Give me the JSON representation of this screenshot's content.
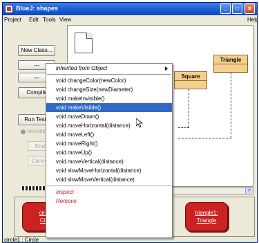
{
  "window": {
    "title": "BlueJ:  shapes",
    "buttons": {
      "minimize": "_",
      "maximize": "□",
      "close": "✕"
    }
  },
  "menubar": [
    "Project",
    "Edit",
    "Tools",
    "View",
    "Help"
  ],
  "sidebar": {
    "new_class": "New Class...",
    "arrow_btn_1": "---",
    "arrow_btn_2": "—",
    "compile": "Compile",
    "run_tests": "Run Tests",
    "recording": "recording",
    "end": "End",
    "cancel": "Cancel"
  },
  "diagram": {
    "classes": [
      {
        "name": "Triangle"
      },
      {
        "name": "Square"
      }
    ]
  },
  "context_menu": {
    "inherited": "inherited from Object",
    "methods": [
      "void changeColor(newColor)",
      "void changeSize(newDiameter)",
      "void makeInvisible()",
      "void makeVisible()",
      "void moveDown()",
      "void moveHorizontal(distance)",
      "void moveLeft()",
      "void moveRight()",
      "void moveUp()",
      "void moveVertical(distance)",
      "void slowMoveHorizontal(distance)",
      "void slowMoveVertical(distance)"
    ],
    "highlighted_index": 3,
    "inspect": "Inspect",
    "remove": "Remove"
  },
  "object_bench": {
    "objects": [
      {
        "name_line1": "circ",
        "name_line2": "Cir"
      },
      {
        "name_line1": "triangle1:",
        "name_line2": "Triangle"
      }
    ]
  },
  "status": "circle1 : Circle",
  "colors": {
    "class_fill": "#f4cf8d",
    "object_fill": "#cc2222",
    "menu_highlight": "#316ac5",
    "title_bar": "#1f5fd8"
  }
}
